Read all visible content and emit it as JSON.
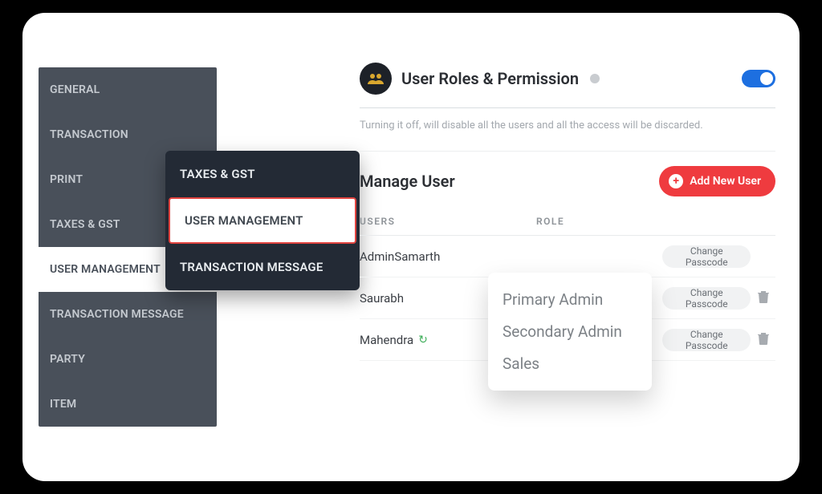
{
  "sidebar": {
    "items": [
      {
        "label": "GENERAL"
      },
      {
        "label": "TRANSACTION"
      },
      {
        "label": "PRINT"
      },
      {
        "label": "TAXES & GST"
      },
      {
        "label": "USER MANAGEMENT"
      },
      {
        "label": "TRANSACTION MESSAGE"
      },
      {
        "label": "PARTY"
      },
      {
        "label": "ITEM"
      }
    ],
    "active_index": 4
  },
  "subnav": {
    "items": [
      {
        "label": "TAXES & GST"
      },
      {
        "label": "USER MANAGEMENT"
      },
      {
        "label": "TRANSACTION MESSAGE"
      }
    ],
    "selected_index": 1
  },
  "header": {
    "title": "User Roles & Permission",
    "note": "Turning it off, will disable all the users and all the access will be discarded.",
    "toggle_on": true
  },
  "manage": {
    "title": "Manage User",
    "add_label": "Add New User",
    "col_user": "USERS",
    "col_role": "ROLE",
    "change_label": "Change Passcode"
  },
  "users": [
    {
      "name": "AdminSamarth",
      "role": "",
      "sync": false,
      "delete": false
    },
    {
      "name": "Saurabh",
      "role": "",
      "sync": false,
      "delete": true
    },
    {
      "name": "Mahendra",
      "role": "",
      "sync": true,
      "delete": true
    }
  ],
  "roles_popup": [
    "Primary Admin",
    "Secondary Admin",
    "Sales"
  ]
}
